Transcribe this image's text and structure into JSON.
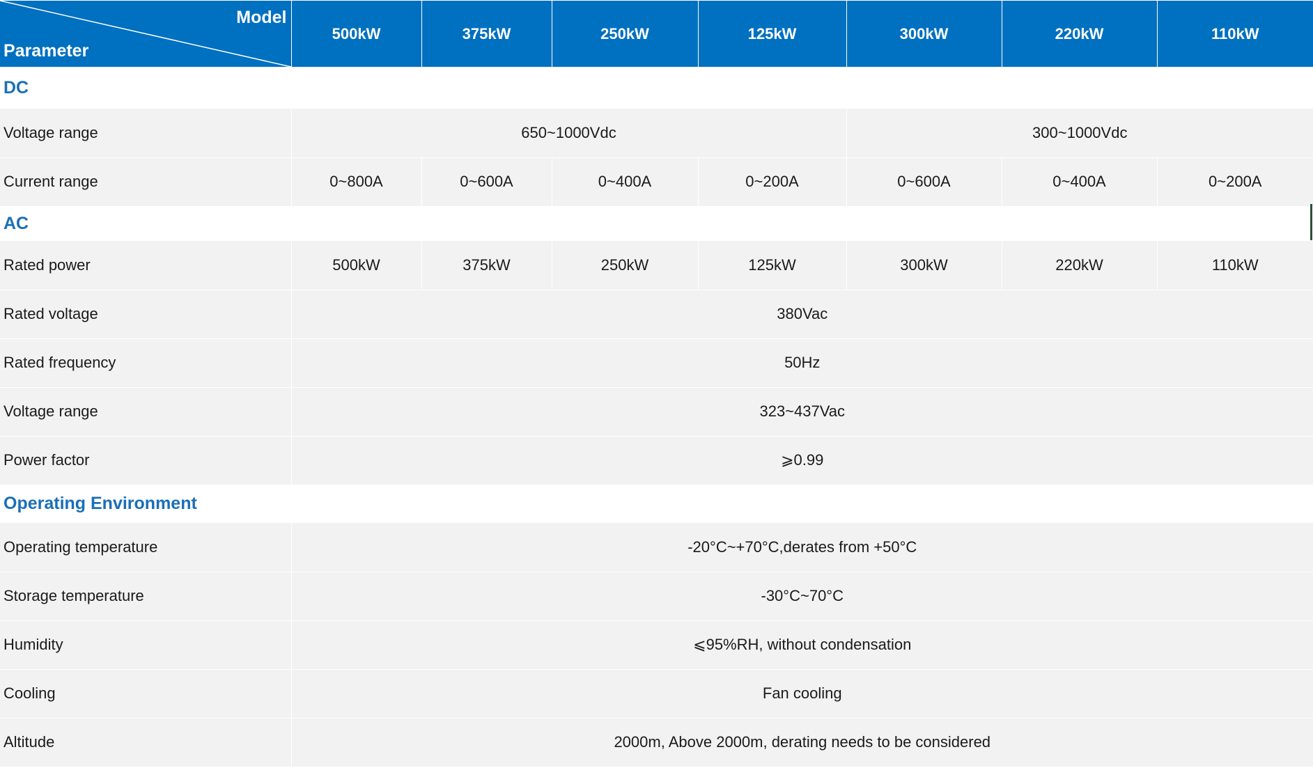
{
  "header": {
    "corner_model": "Model",
    "corner_parameter": "Parameter",
    "models": [
      "500kW",
      "375kW",
      "250kW",
      "125kW",
      "300kW",
      "220kW",
      "110kW"
    ]
  },
  "sections": {
    "dc": {
      "title": "DC",
      "voltage_range": {
        "label": "Voltage range",
        "group_a": "650~1000Vdc",
        "group_b": "300~1000Vdc"
      },
      "current_range": {
        "label": "Current range",
        "values": [
          "0~800A",
          "0~600A",
          "0~400A",
          "0~200A",
          "0~600A",
          "0~400A",
          "0~200A"
        ]
      }
    },
    "ac": {
      "title": "AC",
      "rated_power": {
        "label": "Rated power",
        "values": [
          "500kW",
          "375kW",
          "250kW",
          "125kW",
          "300kW",
          "220kW",
          "110kW"
        ]
      },
      "rated_voltage": {
        "label": "Rated voltage",
        "value": "380Vac"
      },
      "rated_frequency": {
        "label": "Rated frequency",
        "value": "50Hz"
      },
      "voltage_range": {
        "label": "Voltage range",
        "value": "323~437Vac"
      },
      "power_factor": {
        "label": "Power factor",
        "value": "⩾0.99"
      }
    },
    "env": {
      "title": "Operating Environment",
      "operating_temperature": {
        "label": "Operating temperature",
        "value": "-20°C~+70°C,derates from +50°C"
      },
      "storage_temperature": {
        "label": "Storage temperature",
        "value": "-30°C~70°C"
      },
      "humidity": {
        "label": "Humidity",
        "value": "⩽95%RH, without condensation"
      },
      "cooling": {
        "label": "Cooling",
        "value": "Fan cooling"
      },
      "altitude": {
        "label": "Altitude",
        "value": "2000m, Above 2000m, derating needs to be considered"
      }
    }
  },
  "colors": {
    "header_bg": "#0070c0",
    "section_title": "#1a6fb8",
    "row_bg": "#f2f2f2"
  }
}
